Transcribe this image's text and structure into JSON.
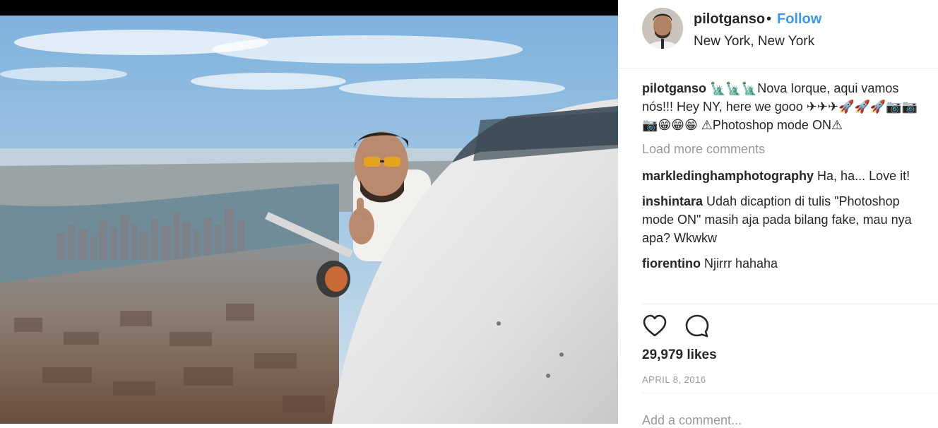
{
  "post": {
    "username": "pilotganso",
    "separator": "•",
    "follow_label": "Follow",
    "location": "New York, New York",
    "caption_user": "pilotganso",
    "caption_text": "🗽🗽🗽Nova Iorque, aqui vamos nós!!! Hey NY, here we gooo ✈✈✈🚀🚀🚀📷📷📷😁😁😁 ⚠Photoshop mode ON⚠",
    "load_more": "Load more comments",
    "comments": [
      {
        "user": "markledinghamphotography",
        "text": "Ha, ha... Love it!"
      },
      {
        "user": "inshintara",
        "text": "Udah dicaption di tulis \"Photoshop mode ON\" masih aja pada bilang fake, mau nya apa? Wkwkw"
      },
      {
        "user": "fiorentino",
        "text": "Njirrr hahaha"
      }
    ],
    "likes": "29,979 likes",
    "date": "APRIL 8, 2016",
    "add_comment_placeholder": "Add a comment..."
  },
  "icons": {
    "like": "heart-icon",
    "comment": "comment-icon"
  },
  "colors": {
    "link": "#3897f0",
    "muted": "#999999",
    "text": "#262626"
  }
}
